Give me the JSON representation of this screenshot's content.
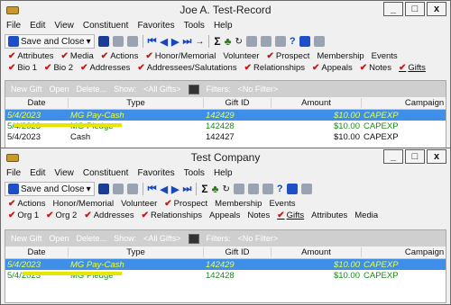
{
  "windows": [
    {
      "title": "Joe A. Test-Record",
      "menu": [
        "File",
        "Edit",
        "View",
        "Constituent",
        "Favorites",
        "Tools",
        "Help"
      ],
      "save_label": "Save and Close",
      "tabs_row1": [
        "Attributes",
        "Media",
        "Actions",
        "Honor/Memorial",
        "Volunteer",
        "Prospect",
        "Membership",
        "Events"
      ],
      "tabs_row2": [
        "Bio 1",
        "Bio 2",
        "Addresses",
        "Addressees/Salutations",
        "Relationships",
        "Appeals",
        "Notes",
        "Gifts"
      ],
      "sub_toolbar": {
        "new_gift": "New Gift",
        "open": "Open",
        "delete": "Delete...",
        "show_label": "Show:",
        "show_value": "<All Gifts>",
        "filters_label": "Filters:",
        "filters_value": "<No Filter>"
      },
      "columns": [
        "Date",
        "Type",
        "Gift ID",
        "Amount",
        "Campaign"
      ],
      "rows": [
        {
          "date": "5/4/2023",
          "type": "MG Pay-Cash",
          "gift_id": "142429",
          "amount": "$10.00",
          "campaign": "CAPEXP"
        },
        {
          "date": "5/4/2023",
          "type": "MG Pledge",
          "gift_id": "142428",
          "amount": "$10.00",
          "campaign": "CAPEXP"
        },
        {
          "date": "5/4/2023",
          "type": "Cash",
          "gift_id": "142427",
          "amount": "$10.00",
          "campaign": "CAPEXP"
        }
      ]
    },
    {
      "title": "Test Company",
      "menu": [
        "File",
        "Edit",
        "View",
        "Constituent",
        "Favorites",
        "Tools",
        "Help"
      ],
      "save_label": "Save and Close",
      "tabs_row1": [
        "Actions",
        "Honor/Memorial",
        "Volunteer",
        "Prospect",
        "Membership",
        "Events"
      ],
      "tabs_row2": [
        "Org 1",
        "Org 2",
        "Addresses",
        "Relationships",
        "Appeals",
        "Notes",
        "Gifts",
        "Attributes",
        "Media"
      ],
      "sub_toolbar": {
        "new_gift": "New Gift",
        "open": "Open",
        "delete": "Delete...",
        "show_label": "Show:",
        "show_value": "<All Gifts>",
        "filters_label": "Filters:",
        "filters_value": "<No Filter>"
      },
      "columns": [
        "Date",
        "Type",
        "Gift ID",
        "Amount",
        "Campaign"
      ],
      "rows": [
        {
          "date": "5/4/2023",
          "type": "MG Pay-Cash",
          "gift_id": "142429",
          "amount": "$10.00",
          "campaign": "CAPEXP"
        },
        {
          "date": "5/4/2023",
          "type": "MG Pledge",
          "gift_id": "142428",
          "amount": "$10.00",
          "campaign": "CAPEXP"
        }
      ]
    }
  ],
  "window_buttons": {
    "minimize": "_",
    "maximize": "□",
    "close": "x"
  },
  "colors": {
    "selection": "#3f8fe8",
    "selected_text": "#e8ff4a",
    "green_row": "#1a8c1a",
    "highlight": "#e6e600",
    "check": "#c41a1a"
  }
}
